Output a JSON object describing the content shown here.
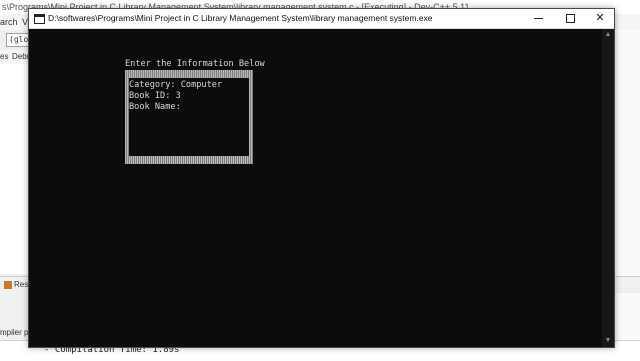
{
  "ide": {
    "title": "s\\Programs\\Mini Project in C Library Management System\\library management system.c - [Executing] - Dev-C++ 5.11",
    "menu": [
      "arch",
      "Vi"
    ],
    "scope_value": "(glob",
    "tabs": [
      "es",
      "Debu"
    ],
    "bottom_tab": "Res",
    "compiler_label": "mpiler pat",
    "log_line": "- Compilation Time: 1.89s"
  },
  "console": {
    "title": "D:\\softwares\\Programs\\Mini Project in C Library Management System\\library management system.exe",
    "heading": "Enter the Information Below",
    "fields": {
      "category": "Category: Computer",
      "book_id": "Book ID: 3",
      "book_name": "Book Name:"
    }
  },
  "icons": {
    "app": "console-app-icon",
    "minimize": "minimize-icon",
    "maximize": "maximize-icon",
    "close": "close-icon"
  }
}
